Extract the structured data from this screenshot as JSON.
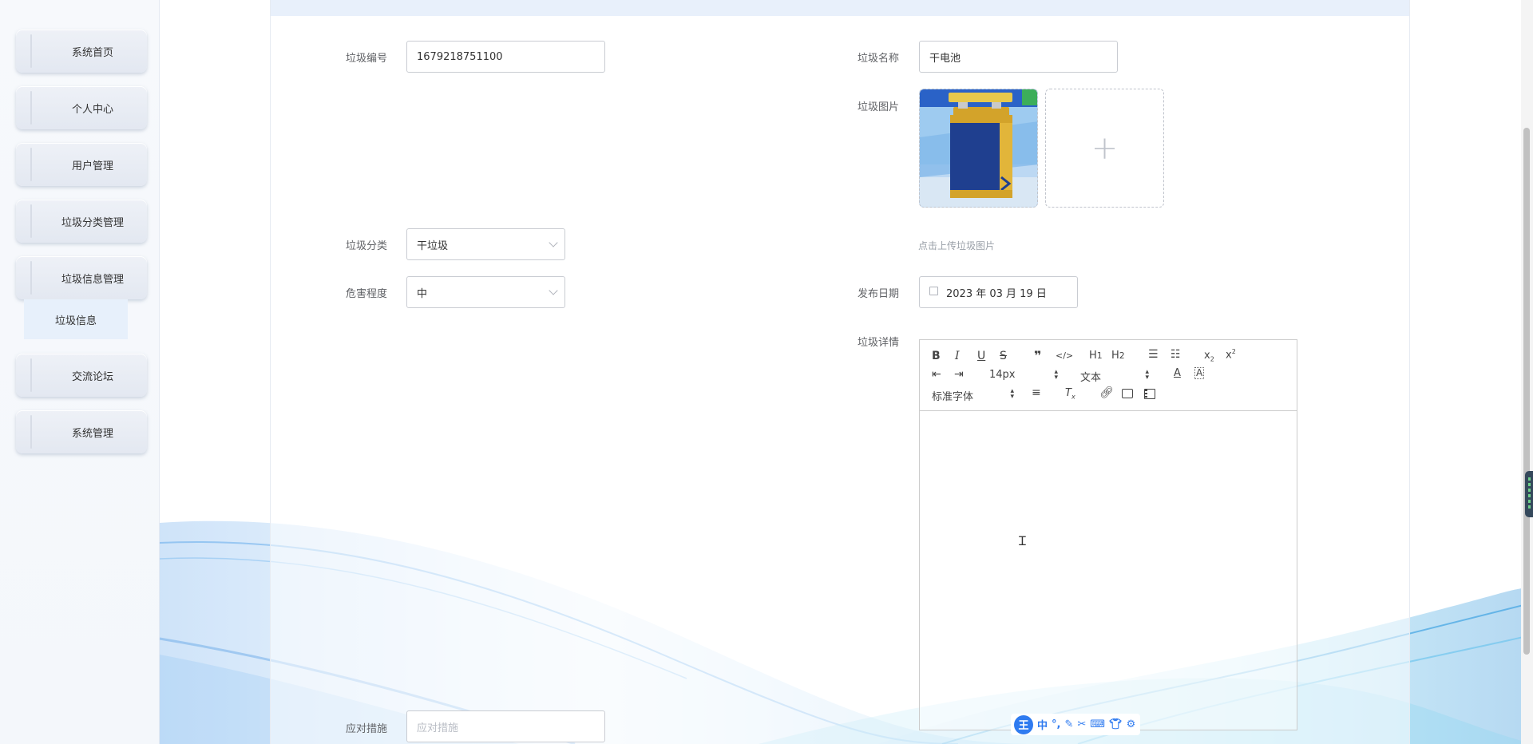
{
  "sidebar": {
    "items": [
      {
        "label": "系统首页"
      },
      {
        "label": "个人中心"
      },
      {
        "label": "用户管理"
      },
      {
        "label": "垃圾分类管理"
      },
      {
        "label": "垃圾信息管理"
      },
      {
        "label": "交流论坛"
      },
      {
        "label": "系统管理"
      }
    ],
    "submenu": {
      "label": "垃圾信息"
    }
  },
  "form": {
    "code": {
      "label": "垃圾编号",
      "value": "1679218751100"
    },
    "name": {
      "label": "垃圾名称",
      "value": "干电池"
    },
    "image": {
      "label": "垃圾图片",
      "hint": "点击上传垃圾图片",
      "add_symbol": "+"
    },
    "category": {
      "label": "垃圾分类",
      "value": "干垃圾"
    },
    "hazard": {
      "label": "危害程度",
      "value": "中"
    },
    "date": {
      "label": "发布日期",
      "value": "2023 年 03 月 19 日"
    },
    "detail": {
      "label": "垃圾详情"
    },
    "measures": {
      "label": "应对措施",
      "placeholder": "应对措施"
    }
  },
  "editor": {
    "font_size": "14px",
    "heading": "文本",
    "font_family": "标准字体"
  },
  "ime": {
    "logo": "王",
    "mode": "中"
  },
  "colors": {
    "accent": "#2f7bf0",
    "menu_bg": "#e3e8f1",
    "submenu_bg": "#e7f0fb"
  }
}
